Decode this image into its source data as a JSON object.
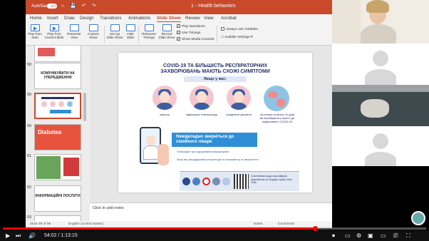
{
  "titlebar": {
    "autosave": "AutoSave",
    "toggle": "OFF",
    "document_title": "1 - Health behaviors"
  },
  "ribbon_tabs": [
    "Home",
    "Insert",
    "Draw",
    "Design",
    "Transitions",
    "Animations",
    "Slide Show",
    "Review",
    "View",
    "Acrobat"
  ],
  "active_tab": "Slide Show",
  "ribbon": {
    "play_from_start": "Play from Start",
    "play_from_current": "Play from Current Slide",
    "presenter_view": "Presenter View",
    "custom_show": "Custom Show",
    "set_up": "Set Up Slide Show",
    "hide_slide": "Hide Slide",
    "rehearse": "Rehearse Timings",
    "record": "Record Slide Show",
    "checks": [
      "Play Narrations",
      "Use Timings",
      "Show Media Controls"
    ],
    "always_subtitles": "Always Use Subtitles",
    "subtitle_settings": "Subtitle Settings"
  },
  "thumbnails": [
    {
      "num": "",
      "text": "",
      "kind": "partial"
    },
    {
      "num": "58",
      "text": "КОМУНІКУВАТИ НА УПЕРЕДЖЕННЯ",
      "kind": "text"
    },
    {
      "num": "59",
      "text": "",
      "kind": "selected"
    },
    {
      "num": "60",
      "text": "Diabetes",
      "kind": "pic"
    },
    {
      "num": "61",
      "text": "",
      "kind": "pic2"
    },
    {
      "num": "62",
      "text": "ІНФОРМАЦІЙНІ ПОСЛУГИ",
      "kind": "text"
    },
    {
      "num": "63",
      "text": "",
      "kind": "doc"
    }
  ],
  "slide": {
    "title": "COVID-19 ТА БІЛЬШІСТЬ РЕСПІРАТОРНИХ ЗАХВОРЮВАНЬ МАЮТЬ СХОЖІ СИМПТОМИ",
    "subtitle": "Якщо у вас:",
    "symptoms": [
      "кашель",
      "підвищена температура",
      "утруднене дихання",
      "протягом останніх 14 днів ви перебували у країні, де зафіксовано COVID-19"
    ],
    "callout": "Невідкладно зверніться до сімейного лікаря",
    "advice_1": "Попередьте про підозрювання вашим краян",
    "advice_2": "Лікар вас затриджуємий алгоритм дій та злишьменту, як хвороплітти",
    "footer_text": "Із питаннями щодо коронавірусу звертайтеся на Урядову гарячу лінію 1545"
  },
  "notes_placeholder": "Click to add notes",
  "statusbar": {
    "slide_info": "Slide 59 of 96",
    "language": "English (United States)",
    "notes": "Notes",
    "comments": "Comments"
  },
  "player": {
    "time": "54:02 / 1:13:15",
    "progress": 0.737
  }
}
